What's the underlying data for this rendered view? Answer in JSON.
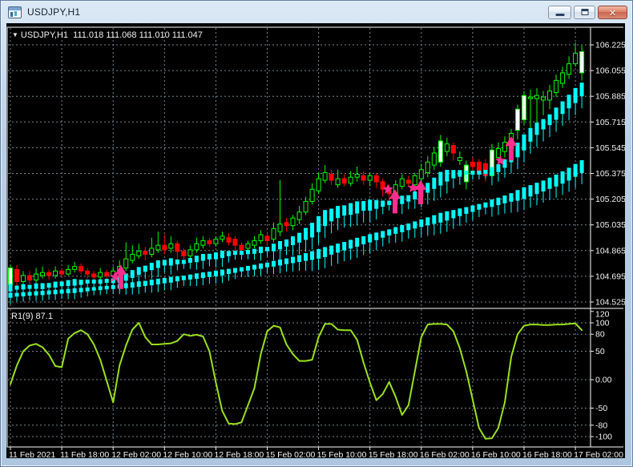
{
  "window": {
    "title": "USDJPY,H1"
  },
  "header": {
    "dropdown_glyph": "▼",
    "symbol": "USDJPY,H1",
    "open": "111.018",
    "high": "111.068",
    "low": "111.010",
    "close": "111.047"
  },
  "oscillator_label": "R1(9) 87.1",
  "colors": {
    "background": "#000000",
    "grid": "#77858F",
    "axis_text": "#F2F2F2",
    "panel_border": "#FFFFFF",
    "candle_up": "#00FF00",
    "candle_down": "#FF0000",
    "bull_fill": "#FFFFFF",
    "dots": "#00FFFF",
    "signal": "#FF2D8E",
    "oscillator_line": "#99E01A"
  },
  "chart_data": {
    "type": "candlestick",
    "symbol": "USDJPY",
    "timeframe": "H1",
    "price_axis": {
      "labels": [
        "106.225",
        "106.055",
        "105.885",
        "105.715",
        "105.545",
        "105.375",
        "105.205",
        "105.035",
        "104.865",
        "104.695",
        "104.525"
      ],
      "max": 106.225,
      "min": 104.525,
      "step": 0.17
    },
    "osc_axis": {
      "labels": [
        "120",
        "100",
        "80",
        "50",
        "0.00",
        "-50",
        "-80",
        "-100"
      ],
      "values": [
        120,
        100,
        80,
        50,
        0,
        -50,
        -80,
        -100
      ],
      "range": [
        -120,
        120
      ]
    },
    "time_axis": {
      "labels": [
        "11 Feb 2021",
        "11 Feb 18:00",
        "12 Feb 02:00",
        "12 Feb 10:00",
        "12 Feb 18:00",
        "15 Feb 02:00",
        "15 Feb 10:00",
        "15 Feb 18:00",
        "16 Feb 02:00",
        "16 Feb 10:00",
        "16 Feb 18:00",
        "17 Feb 02:00"
      ],
      "bars_per_tick": 8
    },
    "candles": [
      [
        104.64,
        104.77,
        104.6,
        104.75
      ],
      [
        104.74,
        104.77,
        104.62,
        104.66
      ],
      [
        104.66,
        104.73,
        104.63,
        104.7
      ],
      [
        104.7,
        104.73,
        104.64,
        104.67
      ],
      [
        104.67,
        104.75,
        104.65,
        104.71
      ],
      [
        104.7,
        104.76,
        104.68,
        104.72
      ],
      [
        104.72,
        104.74,
        104.67,
        104.7
      ],
      [
        104.7,
        104.76,
        104.68,
        104.73
      ],
      [
        104.73,
        104.75,
        104.69,
        104.71
      ],
      [
        104.71,
        104.77,
        104.7,
        104.74
      ],
      [
        104.74,
        104.79,
        104.72,
        104.76
      ],
      [
        104.76,
        104.78,
        104.71,
        104.73
      ],
      [
        104.73,
        104.75,
        104.68,
        104.71
      ],
      [
        104.71,
        104.73,
        104.65,
        104.69
      ],
      [
        104.69,
        104.75,
        104.67,
        104.72
      ],
      [
        104.72,
        104.74,
        104.68,
        104.7
      ],
      [
        104.7,
        104.76,
        104.66,
        104.73
      ],
      [
        104.73,
        104.8,
        104.68,
        104.76
      ],
      [
        104.75,
        104.92,
        104.73,
        104.81
      ],
      [
        104.8,
        104.9,
        104.78,
        104.84
      ],
      [
        104.83,
        104.91,
        104.81,
        104.86
      ],
      [
        104.86,
        104.89,
        104.8,
        104.84
      ],
      [
        104.84,
        104.95,
        104.82,
        104.88
      ],
      [
        104.87,
        104.99,
        104.85,
        104.9
      ],
      [
        104.9,
        104.97,
        104.84,
        104.87
      ],
      [
        104.88,
        104.96,
        104.85,
        104.91
      ],
      [
        104.91,
        104.93,
        104.81,
        104.86
      ],
      [
        104.86,
        104.88,
        104.8,
        104.83
      ],
      [
        104.83,
        104.9,
        104.81,
        104.87
      ],
      [
        104.87,
        104.95,
        104.85,
        104.91
      ],
      [
        104.9,
        104.96,
        104.88,
        104.93
      ],
      [
        104.93,
        104.95,
        104.89,
        104.91
      ],
      [
        104.91,
        104.96,
        104.89,
        104.94
      ],
      [
        104.94,
        104.99,
        104.92,
        104.96
      ],
      [
        104.95,
        104.98,
        104.9,
        104.92
      ],
      [
        104.94,
        104.96,
        104.86,
        104.9
      ],
      [
        104.9,
        104.92,
        104.84,
        104.87
      ],
      [
        104.88,
        104.93,
        104.85,
        104.91
      ],
      [
        104.9,
        104.96,
        104.88,
        104.93
      ],
      [
        104.93,
        105.0,
        104.91,
        104.97
      ],
      [
        104.96,
        104.98,
        104.9,
        104.93
      ],
      [
        104.94,
        105.05,
        104.92,
        105.01
      ],
      [
        104.99,
        105.33,
        104.96,
        105.04
      ],
      [
        105.05,
        105.08,
        104.99,
        105.03
      ],
      [
        105.03,
        105.1,
        105.0,
        105.08
      ],
      [
        105.07,
        105.16,
        105.04,
        105.12
      ],
      [
        105.12,
        105.22,
        105.1,
        105.19
      ],
      [
        105.19,
        105.31,
        105.17,
        105.27
      ],
      [
        105.26,
        105.38,
        105.24,
        105.34
      ],
      [
        105.33,
        105.43,
        105.31,
        105.38
      ],
      [
        105.37,
        105.4,
        105.3,
        105.33
      ],
      [
        105.3,
        105.4,
        105.28,
        105.34
      ],
      [
        105.34,
        105.37,
        105.29,
        105.31
      ],
      [
        105.31,
        105.39,
        105.29,
        105.35
      ],
      [
        105.35,
        105.42,
        105.32,
        105.37
      ],
      [
        105.36,
        105.39,
        105.3,
        105.33
      ],
      [
        105.33,
        105.38,
        105.29,
        105.36
      ],
      [
        105.36,
        105.38,
        105.28,
        105.32
      ],
      [
        105.32,
        105.34,
        105.22,
        105.27
      ],
      [
        105.27,
        105.3,
        105.19,
        105.24
      ],
      [
        105.24,
        105.33,
        105.21,
        105.3
      ],
      [
        105.29,
        105.37,
        105.27,
        105.34
      ],
      [
        105.33,
        105.36,
        105.29,
        105.31
      ],
      [
        105.3,
        105.38,
        105.28,
        105.36
      ],
      [
        105.34,
        105.44,
        105.28,
        105.4
      ],
      [
        105.38,
        105.49,
        105.35,
        105.45
      ],
      [
        105.43,
        105.55,
        105.4,
        105.51
      ],
      [
        105.45,
        105.63,
        105.42,
        105.59
      ],
      [
        105.52,
        105.61,
        105.49,
        105.57
      ],
      [
        105.56,
        105.58,
        105.46,
        105.51
      ],
      [
        105.46,
        105.52,
        105.43,
        105.48
      ],
      [
        105.32,
        105.46,
        105.27,
        105.43
      ],
      [
        105.45,
        105.48,
        105.38,
        105.42
      ],
      [
        105.45,
        105.47,
        105.34,
        105.38
      ],
      [
        105.44,
        105.47,
        105.32,
        105.36
      ],
      [
        105.36,
        105.57,
        105.33,
        105.53
      ],
      [
        105.48,
        105.58,
        105.44,
        105.54
      ],
      [
        105.52,
        105.62,
        105.48,
        105.58
      ],
      [
        105.56,
        105.67,
        105.52,
        105.64
      ],
      [
        105.66,
        105.83,
        105.6,
        105.8
      ],
      [
        105.73,
        105.92,
        105.7,
        105.89
      ],
      [
        105.87,
        105.93,
        105.66,
        105.88
      ],
      [
        105.87,
        105.94,
        105.7,
        105.89
      ],
      [
        105.86,
        105.92,
        105.76,
        105.88
      ],
      [
        105.86,
        105.96,
        105.8,
        105.92
      ],
      [
        105.91,
        106.03,
        105.88,
        105.99
      ],
      [
        105.97,
        106.08,
        105.94,
        106.04
      ],
      [
        106.03,
        106.15,
        106.0,
        106.1
      ],
      [
        106.1,
        106.24,
        106.08,
        106.17
      ],
      [
        106.04,
        106.22,
        105.99,
        106.18
      ]
    ],
    "dots_fast": [
      104.62,
      104.62,
      104.625,
      104.625,
      104.63,
      104.63,
      104.635,
      104.64,
      104.645,
      104.65,
      104.655,
      104.655,
      104.66,
      104.66,
      104.66,
      104.665,
      104.665,
      104.67,
      104.69,
      104.71,
      104.73,
      104.745,
      104.76,
      104.775,
      104.785,
      104.79,
      104.79,
      104.79,
      104.8,
      104.81,
      104.82,
      104.825,
      104.83,
      104.84,
      104.845,
      104.85,
      104.85,
      104.855,
      104.86,
      104.87,
      104.875,
      104.885,
      104.9,
      104.915,
      104.93,
      104.95,
      104.975,
      105.0,
      105.04,
      105.08,
      105.1,
      105.12,
      105.13,
      105.14,
      105.15,
      105.16,
      105.165,
      105.17,
      105.175,
      105.18,
      105.19,
      105.2,
      105.21,
      105.23,
      105.25,
      105.28,
      105.31,
      105.34,
      105.36,
      105.37,
      105.375,
      105.38,
      105.38,
      105.38,
      105.385,
      105.39,
      105.41,
      105.44,
      105.48,
      105.53,
      105.58,
      105.63,
      105.67,
      105.7,
      105.73,
      105.77,
      105.81,
      105.85,
      105.89,
      105.93
    ],
    "dots_slow": [
      104.57,
      104.573,
      104.576,
      104.579,
      104.582,
      104.585,
      104.588,
      104.591,
      104.594,
      104.597,
      104.6,
      104.604,
      104.608,
      104.612,
      104.616,
      104.62,
      104.624,
      104.628,
      104.633,
      104.638,
      104.643,
      104.648,
      104.654,
      104.66,
      104.666,
      104.672,
      104.678,
      104.684,
      104.69,
      104.696,
      104.702,
      104.708,
      104.714,
      104.72,
      104.727,
      104.734,
      104.741,
      104.748,
      104.755,
      104.762,
      104.77,
      104.778,
      104.786,
      104.794,
      104.803,
      104.812,
      104.822,
      104.832,
      104.843,
      104.855,
      104.868,
      104.881,
      104.894,
      104.907,
      104.92,
      104.933,
      104.946,
      104.959,
      104.972,
      104.985,
      104.998,
      105.01,
      105.022,
      105.034,
      105.046,
      105.058,
      105.07,
      105.082,
      105.094,
      105.106,
      105.118,
      105.13,
      105.142,
      105.154,
      105.166,
      105.178,
      105.19,
      105.203,
      105.216,
      105.23,
      105.245,
      105.26,
      105.276,
      105.292,
      105.31,
      105.328,
      105.348,
      105.37,
      105.395,
      105.42
    ],
    "oscillator": [
      -8,
      25,
      50,
      60,
      63,
      57,
      44,
      24,
      22,
      72,
      82,
      87,
      80,
      62,
      35,
      -2,
      -40,
      25,
      60,
      88,
      100,
      75,
      62,
      62,
      63,
      64,
      68,
      80,
      77,
      79,
      76,
      50,
      -5,
      -55,
      -77,
      -78,
      -75,
      -45,
      -15,
      45,
      85,
      95,
      92,
      62,
      45,
      33,
      33,
      35,
      75,
      98,
      98,
      88,
      87,
      87,
      70,
      30,
      -5,
      -36,
      -25,
      -4,
      -30,
      -62,
      -45,
      15,
      75,
      97,
      98,
      98,
      97,
      85,
      55,
      15,
      -35,
      -85,
      -104,
      -103,
      -85,
      -40,
      40,
      80,
      95,
      97,
      97,
      96,
      96,
      97,
      97,
      98,
      99,
      87
    ],
    "signals": {
      "arrows": [
        {
          "bar": 17.2,
          "tip": 104.77
        },
        {
          "bar": 59.9,
          "tip": 105.27
        },
        {
          "bar": 63.9,
          "tip": 105.33
        },
        {
          "bar": 78.0,
          "tip": 105.62
        }
      ],
      "stars": [
        {
          "bar": 16.3,
          "price": 104.69
        },
        {
          "bar": 58.8,
          "price": 105.27
        },
        {
          "bar": 62.7,
          "price": 105.28
        },
        {
          "bar": 76.3,
          "price": 105.46
        }
      ]
    }
  }
}
